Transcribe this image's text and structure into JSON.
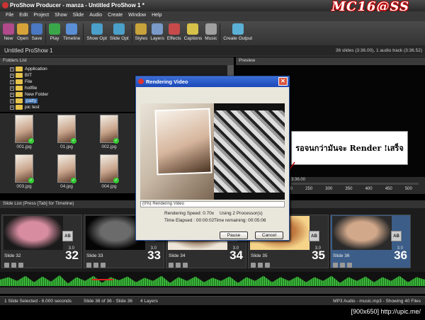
{
  "window": {
    "title": "ProShow Producer - manza - Untitled ProShow 1 *"
  },
  "watermark": {
    "brand": "MC16@SS"
  },
  "menu": [
    "File",
    "Edit",
    "Project",
    "Show",
    "Slide",
    "Audio",
    "Create",
    "Window",
    "Help"
  ],
  "toolbar": [
    {
      "label": "New",
      "icon": "new-icon",
      "color": "#b04a8a"
    },
    {
      "label": "Open",
      "icon": "open-icon",
      "color": "#d6a33a"
    },
    {
      "label": "Save",
      "icon": "save-icon",
      "color": "#4a78c2"
    },
    {
      "label": "Play",
      "icon": "play-icon",
      "color": "#3aa84a"
    },
    {
      "label": "Timeline",
      "icon": "timeline-icon",
      "color": "#5a8fd6"
    },
    {
      "label": "Show Opt",
      "icon": "show-options-icon",
      "color": "#4aa0c8"
    },
    {
      "label": "Slide Opt",
      "icon": "slide-options-icon",
      "color": "#4aa0c8"
    },
    {
      "label": "Styles",
      "icon": "styles-icon",
      "color": "#c8a23a"
    },
    {
      "label": "Layers",
      "icon": "layers-icon",
      "color": "#7a9ac8"
    },
    {
      "label": "Effects",
      "icon": "effects-icon",
      "color": "#c84a4a"
    },
    {
      "label": "Captions",
      "icon": "captions-icon",
      "color": "#d6c24a"
    },
    {
      "label": "Music",
      "icon": "music-icon",
      "color": "#a0a0a0"
    },
    {
      "label": "Create Output",
      "icon": "create-output-icon",
      "color": "#5ab0d6"
    }
  ],
  "project": {
    "name": "Untitled ProShow 1",
    "summary": "36 slides (3:36.00), 1 audio track (3:36.52)"
  },
  "folders": {
    "header": "Folders List",
    "items": [
      {
        "label": "Application"
      },
      {
        "label": "BIT"
      },
      {
        "label": "File"
      },
      {
        "label": "hotfile"
      },
      {
        "label": "New Folder"
      },
      {
        "label": "patty",
        "selected": true
      },
      {
        "label": "pic test"
      }
    ]
  },
  "thumbnails": [
    "001.jpg",
    "01.jpg",
    "002.jpg",
    "003.jpg",
    "04.jpg",
    "004.jpg"
  ],
  "preview": {
    "header": "Preview",
    "timecode": "3:36.00",
    "ruler": [
      "200",
      "250",
      "300",
      "350",
      "400",
      "450",
      "500"
    ]
  },
  "annotation": {
    "text": "รอจนกว่ามันจะ Render !เสร็จ"
  },
  "slide_list": {
    "header": "Slide List (Press [Tab] for Timeline)",
    "slides": [
      {
        "name": "Slide 32",
        "number": "32",
        "transition": "AB",
        "duration": "3.0",
        "color1": "#1a1a1a",
        "color2": "#d78ca0"
      },
      {
        "name": "Slide 33",
        "number": "33",
        "transition": "AB",
        "duration": "3.0",
        "color1": "#050505",
        "color2": "#6b6b6b"
      },
      {
        "name": "Slide 34",
        "number": "34",
        "transition": "AB",
        "duration": "3.0",
        "color1": "#eee6d8",
        "color2": "#8a6a50"
      },
      {
        "name": "Slide 35",
        "number": "35",
        "transition": "AB",
        "duration": "3.0",
        "color1": "#f5d48a",
        "color2": "#c07840"
      },
      {
        "name": "Slide 36",
        "number": "36",
        "transition": "AB",
        "duration": "3.0",
        "color1": "#2a2a2a",
        "color2": "#d2a88a",
        "active": true
      }
    ]
  },
  "status": {
    "selection": "1 Slide Selected - 6.000 seconds",
    "position": "Slide 36 of 36 - Slide 36",
    "layers": "4 Layers",
    "audio": "MP3 Audio - music.mp3 - Showing 40 Files"
  },
  "footer": {
    "text": "[900x650] http://upic.me/"
  },
  "dialog": {
    "title": "Rendering Video",
    "progress_label": "(0%) Rendering Video",
    "progress": 0.0,
    "speed": "Rendering Speed: 0.70x",
    "processors": "Using 2 Processor(s)",
    "elapsed": "Time Elapsed : 00:00:02",
    "remaining": "Time remaining: 00:05:06",
    "pause": "Pause",
    "cancel": "Cancel"
  }
}
